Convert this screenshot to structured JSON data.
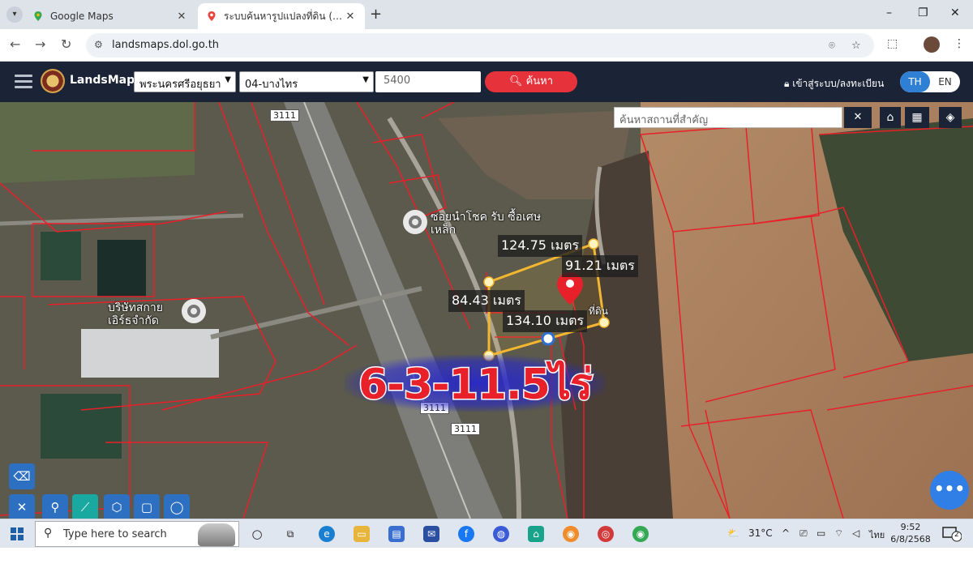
{
  "browser": {
    "tabs": [
      {
        "label": "Google Maps",
        "active": false
      },
      {
        "label": "ระบบค้นหารูปแปลงที่ดิน (LandsMaps)",
        "active": true
      }
    ],
    "url": "landsmaps.dol.go.th",
    "window_controls": [
      "–",
      "❐",
      "✕"
    ]
  },
  "app": {
    "brand": "LandsMaps",
    "province": "พระนครศรีอยุธยา",
    "district": "04-บางไทร",
    "parcel_number": "5400",
    "search_label": "ค้นหา",
    "login_label": "เข้าสู่ระบบ/ลงทะเบียน",
    "lang_th": "TH",
    "lang_en": "EN"
  },
  "map": {
    "place_search_placeholder": "ค้นหาสถานที่สำคัญ",
    "clear_label": "✕",
    "measurements": [
      "124.75 เมตร",
      "91.21 เมตร",
      "84.43 เมตร",
      "134.10 เมตร"
    ],
    "parcel_marker_label": "ที่ดิน",
    "poi": [
      {
        "name": "ซอยนำโชค รับ ซื้อเศษเหล็ก"
      },
      {
        "name": "บริษัทสกาย เอิร์ธจำกัด"
      }
    ],
    "route_labels": [
      "3111",
      "3111",
      "3111"
    ],
    "overlay_text": "6-3-11.5ไร่",
    "fab_label": "•••",
    "colors": {
      "parcel_outline": "#f2b630",
      "boundary": "#e8202a",
      "overlay_text": "#e8202a",
      "overlay_glow": "#2828c8"
    }
  },
  "taskbar": {
    "search_placeholder": "Type here to search",
    "weather": "31°C",
    "input_lang": "ไทย",
    "time": "9:52",
    "date": "6/8/2568",
    "notification_count": "2"
  }
}
